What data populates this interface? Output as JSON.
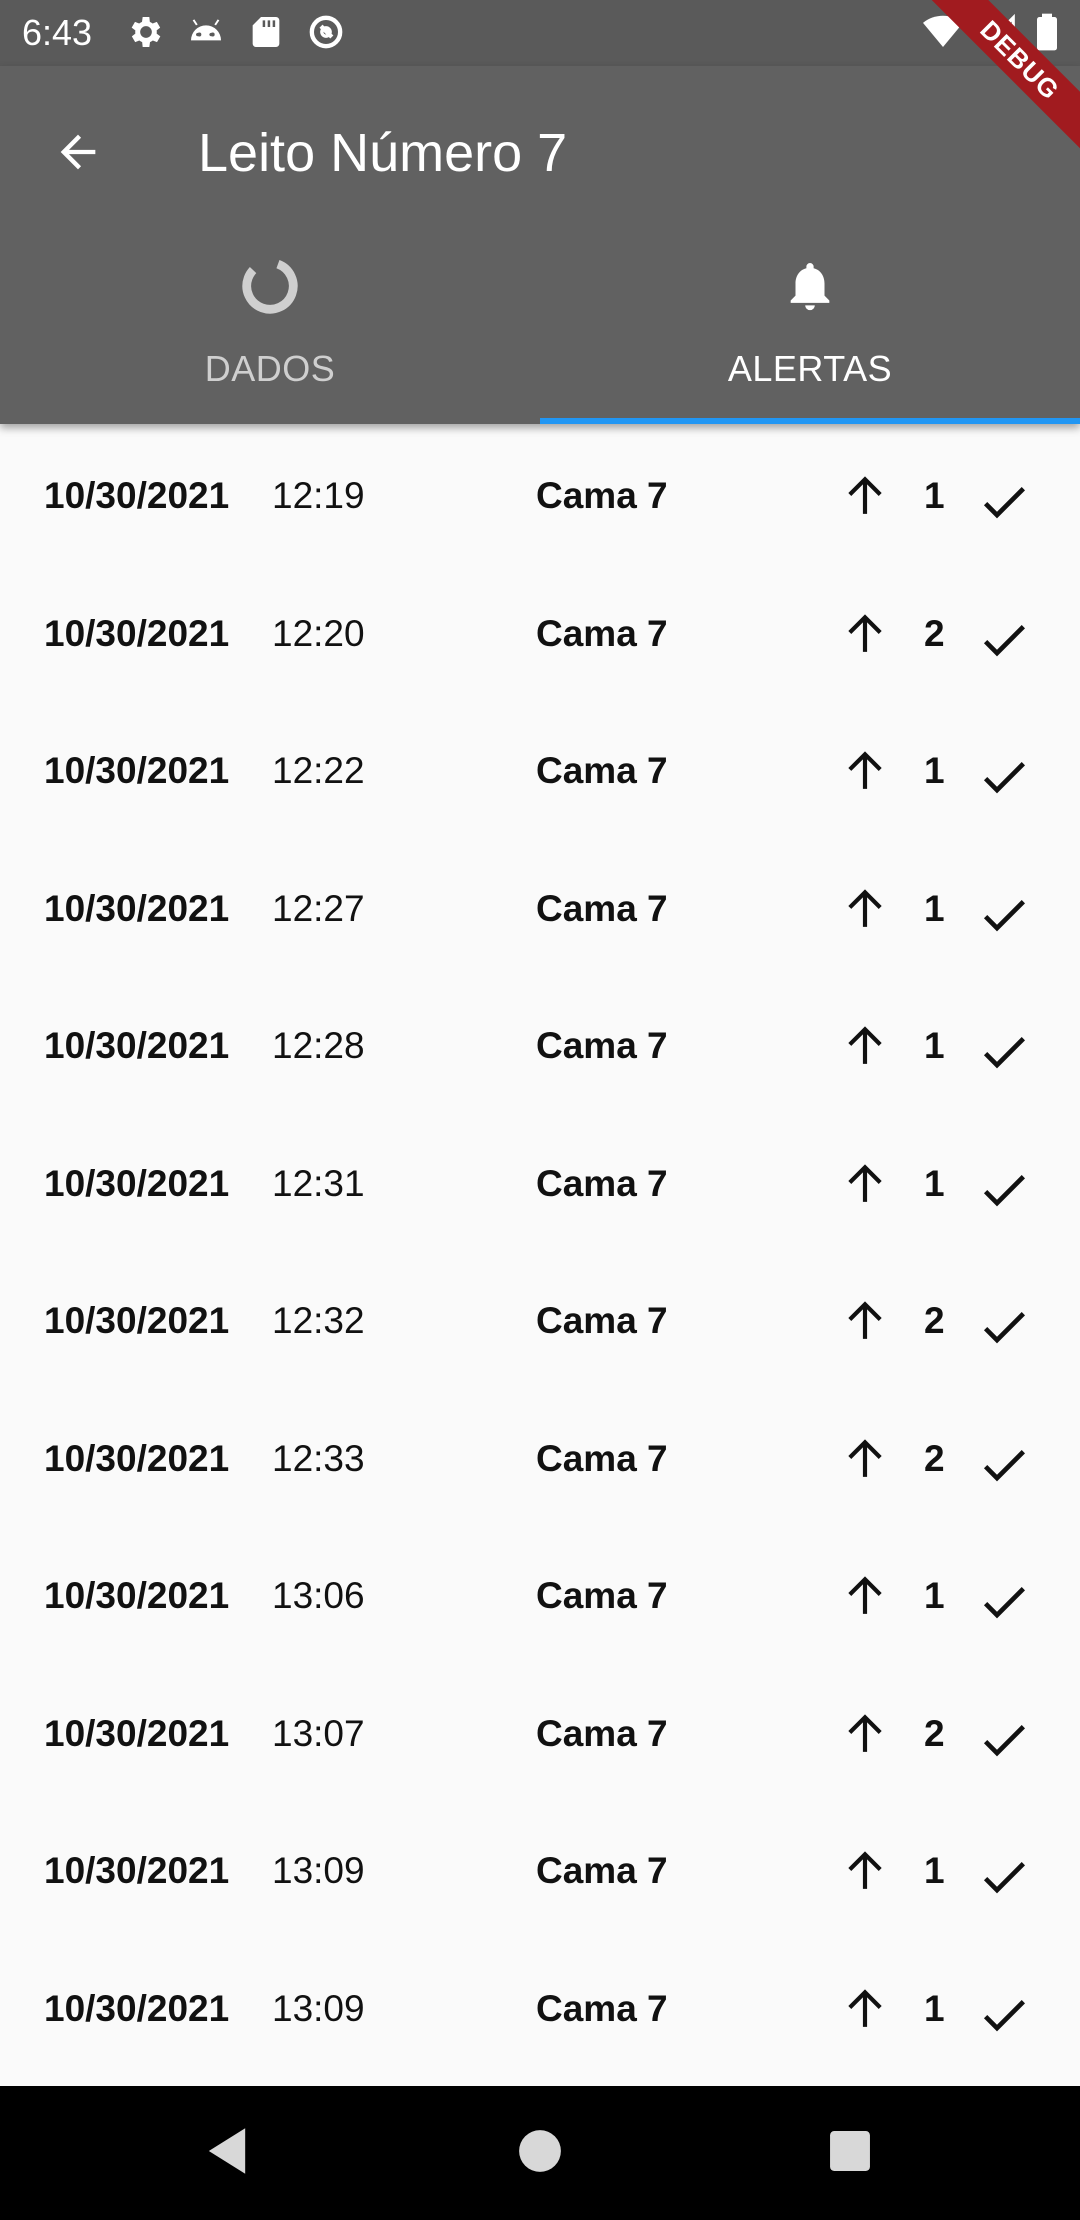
{
  "status_bar": {
    "time": "6:43",
    "left_icons": [
      "gear-icon",
      "android-icon",
      "sd-card-icon",
      "sync-icon"
    ],
    "right_icons": [
      "wifi-icon",
      "signal-icon",
      "battery-icon"
    ]
  },
  "debug_banner": "DEBUG",
  "app_bar": {
    "title": "Leito Número 7",
    "back_icon": "arrow-back-icon"
  },
  "tabs": [
    {
      "label": "DADOS",
      "icon": "loading-ring-icon",
      "selected": false
    },
    {
      "label": "ALERTAS",
      "icon": "bell-icon",
      "selected": true
    }
  ],
  "colors": {
    "app_bar": "#616161",
    "status_bar": "#5a5a5a",
    "tab_indicator": "#2196f3",
    "background": "#fafafa"
  },
  "alerts": [
    {
      "date": "10/30/2021",
      "time": "12:19",
      "bed": "Cama 7",
      "level": "1"
    },
    {
      "date": "10/30/2021",
      "time": "12:20",
      "bed": "Cama 7",
      "level": "2"
    },
    {
      "date": "10/30/2021",
      "time": "12:22",
      "bed": "Cama 7",
      "level": "1"
    },
    {
      "date": "10/30/2021",
      "time": "12:27",
      "bed": "Cama 7",
      "level": "1"
    },
    {
      "date": "10/30/2021",
      "time": "12:28",
      "bed": "Cama 7",
      "level": "1"
    },
    {
      "date": "10/30/2021",
      "time": "12:31",
      "bed": "Cama 7",
      "level": "1"
    },
    {
      "date": "10/30/2021",
      "time": "12:32",
      "bed": "Cama 7",
      "level": "2"
    },
    {
      "date": "10/30/2021",
      "time": "12:33",
      "bed": "Cama 7",
      "level": "2"
    },
    {
      "date": "10/30/2021",
      "time": "13:06",
      "bed": "Cama 7",
      "level": "1"
    },
    {
      "date": "10/30/2021",
      "time": "13:07",
      "bed": "Cama 7",
      "level": "2"
    },
    {
      "date": "10/30/2021",
      "time": "13:09",
      "bed": "Cama 7",
      "level": "1"
    },
    {
      "date": "10/30/2021",
      "time": "13:09",
      "bed": "Cama 7",
      "level": "1"
    }
  ],
  "nav_bar": {
    "icons": [
      "nav-back-icon",
      "nav-home-icon",
      "nav-recents-icon"
    ]
  }
}
